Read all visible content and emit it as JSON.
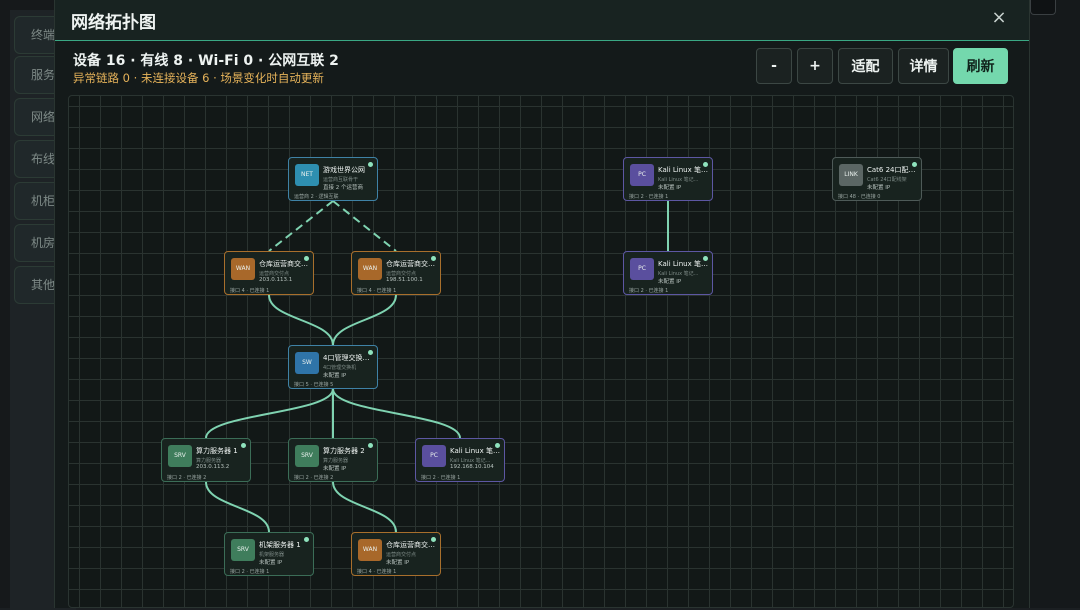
{
  "background": {
    "tabs": [
      "终端",
      "服务器",
      "网络设备",
      "布线设备",
      "机柜",
      "机房设备",
      "其他"
    ]
  },
  "modal": {
    "title": "网络拓扑图",
    "close": "×",
    "stats": "设备 16 · 有线 8 · Wi-Fi 0 · 公网互联 2",
    "warning": "异常链路 0 · 未连接设备 6 · 场景变化时自动更新",
    "buttons": {
      "zoom_out": "-",
      "zoom_in": "+",
      "fit": "适配",
      "details": "详情",
      "refresh": "刷新"
    }
  },
  "colors": {
    "accent": "#74d8ad",
    "warning": "#e6b35a",
    "link": "#7fd3b1"
  },
  "nodes": [
    {
      "id": "net",
      "type": "net",
      "icon": "NET",
      "name": "游戏世界公网",
      "sub1": "运营商互联骨干",
      "sub2": "直接 2 个运营商",
      "foot": "运营商 2 · 逻辑互联"
    },
    {
      "id": "wan1",
      "type": "wan",
      "icon": "WAN",
      "name": "仓库运营商交付点 1",
      "sub1": "运营商交付点",
      "sub2": "203.0.113.1",
      "foot": "接口 4 · 已连接 1"
    },
    {
      "id": "wan2",
      "type": "wan",
      "icon": "WAN",
      "name": "仓库运营商交付点 2",
      "sub1": "运营商交付点",
      "sub2": "198.51.100.1",
      "foot": "接口 4 · 已连接 1"
    },
    {
      "id": "sw",
      "type": "sw",
      "icon": "SW",
      "name": "4口管理交换机 2",
      "sub1": "4口管理交换机",
      "sub2": "未配置 IP",
      "foot": "接口 5 · 已连接 5"
    },
    {
      "id": "srv1",
      "type": "srv",
      "icon": "SRV",
      "name": "算力服务器 1",
      "sub1": "算力服务器",
      "sub2": "203.0.113.2",
      "foot": "接口 2 · 已连接 2"
    },
    {
      "id": "srv2",
      "type": "srv",
      "icon": "SRV",
      "name": "算力服务器 2",
      "sub1": "算力服务器",
      "sub2": "未配置 IP",
      "foot": "接口 2 · 已连接 2"
    },
    {
      "id": "pc3",
      "type": "pc",
      "icon": "PC",
      "name": "Kali Linux 笔记本...",
      "sub1": "Kali Linux 笔记...",
      "sub2": "192.168.10.104",
      "foot": "接口 2 · 已连接 1"
    },
    {
      "id": "rack",
      "type": "srv",
      "icon": "SRV",
      "name": "机架服务器 1",
      "sub1": "机架服务器",
      "sub2": "未配置 IP",
      "foot": "接口 2 · 已连接 1"
    },
    {
      "id": "wan3",
      "type": "wan",
      "icon": "WAN",
      "name": "仓库运营商交付点 3",
      "sub1": "运营商交付点",
      "sub2": "未配置 IP",
      "foot": "接口 4 · 已连接 1"
    },
    {
      "id": "pc1",
      "type": "pc",
      "icon": "PC",
      "name": "Kali Linux 笔记本...",
      "sub1": "Kali Linux 笔记...",
      "sub2": "未配置 IP",
      "foot": "接口 2 · 已连接 1"
    },
    {
      "id": "pc2",
      "type": "pc",
      "icon": "PC",
      "name": "Kali Linux 笔记本...",
      "sub1": "Kali Linux 笔记...",
      "sub2": "未配置 IP",
      "foot": "接口 2 · 已连接 1"
    },
    {
      "id": "patch",
      "type": "link",
      "icon": "LINK",
      "name": "Cat6 24口配线架 1",
      "sub1": "Cat6 24口配线架",
      "sub2": "未配置 IP",
      "foot": "接口 48 · 已连接 0"
    }
  ],
  "links": [
    {
      "from": "net",
      "to": "wan1",
      "style": "dashed"
    },
    {
      "from": "net",
      "to": "wan2",
      "style": "dashed"
    },
    {
      "from": "wan1",
      "to": "sw",
      "style": "solid"
    },
    {
      "from": "wan2",
      "to": "sw",
      "style": "solid"
    },
    {
      "from": "sw",
      "to": "srv1",
      "style": "solid"
    },
    {
      "from": "sw",
      "to": "srv2",
      "style": "solid"
    },
    {
      "from": "sw",
      "to": "pc3",
      "style": "solid"
    },
    {
      "from": "srv1",
      "to": "rack",
      "style": "solid"
    },
    {
      "from": "srv2",
      "to": "wan3",
      "style": "solid"
    },
    {
      "from": "pc1",
      "to": "pc2",
      "style": "solid"
    }
  ]
}
